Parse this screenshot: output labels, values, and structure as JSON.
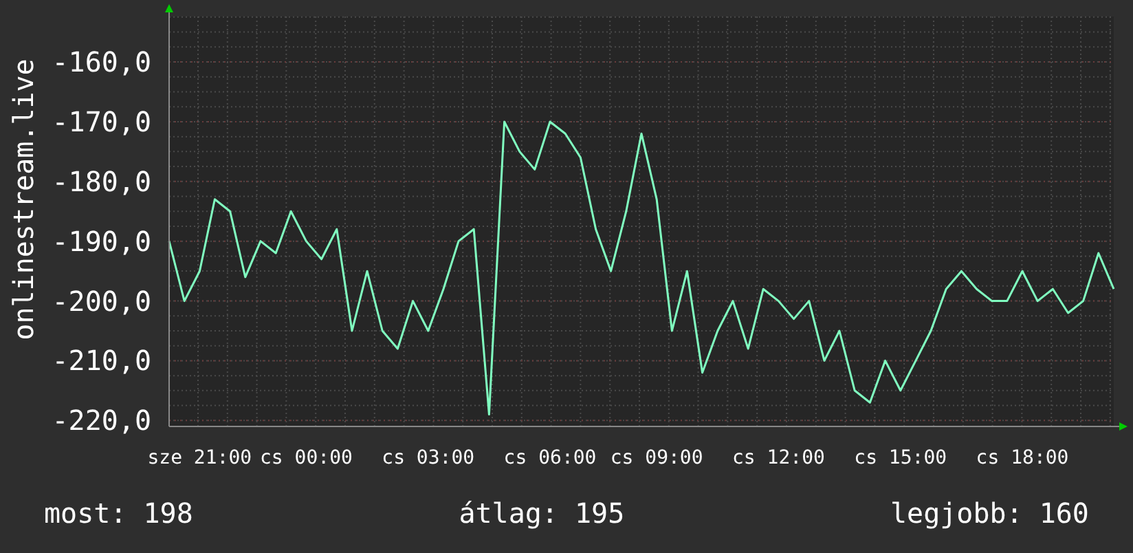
{
  "chart": {
    "chart_data": {
      "type": "line",
      "ylabel": "onlinestream.live",
      "grid": true,
      "ylim": [
        -221,
        -152.4
      ],
      "categories": [
        null,
        null,
        "sze 21:00",
        null,
        null,
        null,
        null,
        null,
        null,
        "cs 00:00",
        null,
        null,
        null,
        null,
        null,
        null,
        null,
        "cs 03:00",
        null,
        null,
        null,
        null,
        null,
        null,
        null,
        "cs 06:00",
        null,
        null,
        null,
        null,
        null,
        null,
        "cs 09:00",
        null,
        null,
        null,
        null,
        null,
        null,
        null,
        "cs 12:00",
        null,
        null,
        null,
        null,
        null,
        null,
        null,
        "cs 15:00",
        null,
        null,
        null,
        null,
        null,
        null,
        null,
        "cs 18:00",
        null,
        null,
        null,
        null,
        null,
        null
      ],
      "yticks": [
        {
          "value": -160,
          "label": "-160,0"
        },
        {
          "value": -170,
          "label": "-170,0"
        },
        {
          "value": -180,
          "label": "-180,0"
        },
        {
          "value": -190,
          "label": "-190,0"
        },
        {
          "value": -200,
          "label": "-200,0"
        },
        {
          "value": -210,
          "label": "-210,0"
        },
        {
          "value": -220,
          "label": "-220,0"
        }
      ],
      "series": [
        {
          "color": "#80ffc0",
          "values": [
            -190,
            -200,
            -195,
            -183,
            -185,
            -196,
            -190,
            -192,
            -185,
            -190,
            -193,
            -188,
            -205,
            -195,
            -205,
            -208,
            -200,
            -205,
            -198,
            -190,
            -188,
            -219,
            -170,
            -175,
            -178,
            -170,
            -172,
            -176,
            -188,
            -195,
            -185,
            -172,
            -183,
            -205,
            -195,
            -212,
            -205,
            -200,
            -208,
            -198,
            -200,
            -203,
            -200,
            -210,
            -205,
            -215,
            -217,
            -210,
            -215,
            -210,
            -205,
            -198,
            -195,
            -198,
            -200,
            -200,
            -195,
            -200,
            -198,
            -202,
            -200,
            -192,
            -198
          ]
        }
      ]
    }
  },
  "footer": [
    {
      "label": "most: 198"
    },
    {
      "label": "átlag: 195"
    },
    {
      "label": "legjobb: 160"
    }
  ]
}
